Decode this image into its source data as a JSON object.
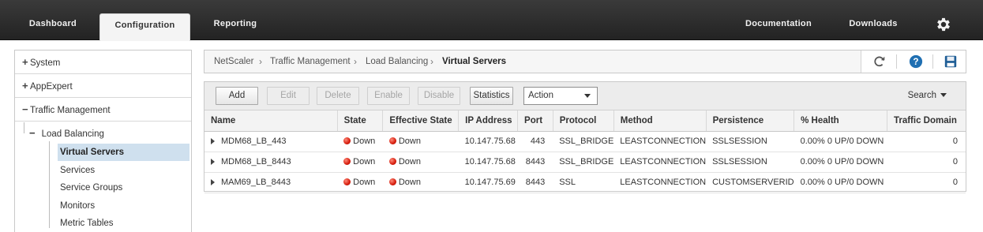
{
  "topnav": {
    "tabs": [
      {
        "label": "Dashboard"
      },
      {
        "label": "Configuration",
        "active": true
      },
      {
        "label": "Reporting"
      }
    ],
    "right_links": [
      {
        "label": "Documentation"
      },
      {
        "label": "Downloads"
      }
    ],
    "settings_icon": "gear-icon"
  },
  "sidebar": {
    "items": [
      {
        "label": "System",
        "state": "collapsed"
      },
      {
        "label": "AppExpert",
        "state": "collapsed"
      },
      {
        "label": "Traffic Management",
        "state": "expanded"
      }
    ],
    "load_balancing": {
      "label": "Load Balancing",
      "state": "expanded"
    },
    "sub_items": [
      {
        "label": "Virtual Servers",
        "selected": true
      },
      {
        "label": "Services"
      },
      {
        "label": "Service Groups"
      },
      {
        "label": "Monitors"
      },
      {
        "label": "Metric Tables"
      }
    ]
  },
  "breadcrumb": {
    "items": [
      "NetScaler",
      "Traffic Management",
      "Load Balancing",
      "Virtual Servers"
    ],
    "tool_icons": [
      "refresh-icon",
      "help-icon",
      "save-icon"
    ]
  },
  "toolbar": {
    "add": "Add",
    "edit": "Edit",
    "delete": "Delete",
    "enable": "Enable",
    "disable": "Disable",
    "statistics": "Statistics",
    "action": "Action",
    "search": "Search"
  },
  "table": {
    "columns": [
      "Name",
      "State",
      "Effective State",
      "IP Address",
      "Port",
      "Protocol",
      "Method",
      "Persistence",
      "% Health",
      "Traffic Domain"
    ],
    "rows": [
      {
        "name": "MDM68_LB_443",
        "state": "Down",
        "effective_state": "Down",
        "ip": "10.147.75.68",
        "port": "443",
        "protocol": "SSL_BRIDGE",
        "method": "LEASTCONNECTION",
        "persistence": "SSLSESSION",
        "health": "0.00% 0 UP/0 DOWN",
        "traffic_domain": "0"
      },
      {
        "name": "MDM68_LB_8443",
        "state": "Down",
        "effective_state": "Down",
        "ip": "10.147.75.68",
        "port": "8443",
        "protocol": "SSL_BRIDGE",
        "method": "LEASTCONNECTION",
        "persistence": "SSLSESSION",
        "health": "0.00% 0 UP/0 DOWN",
        "traffic_domain": "0"
      },
      {
        "name": "MAM69_LB_8443",
        "state": "Down",
        "effective_state": "Down",
        "ip": "10.147.75.69",
        "port": "8443",
        "protocol": "SSL",
        "method": "LEASTCONNECTION",
        "persistence": "CUSTOMSERVERID",
        "health": "0.00% 0 UP/0 DOWN",
        "traffic_domain": "0"
      }
    ]
  },
  "colors": {
    "topbar": "#2d2d2d",
    "status_down": "#d51c0c",
    "selected_nav": "#cfe0ee",
    "help_icon": "#1f6fb2"
  }
}
